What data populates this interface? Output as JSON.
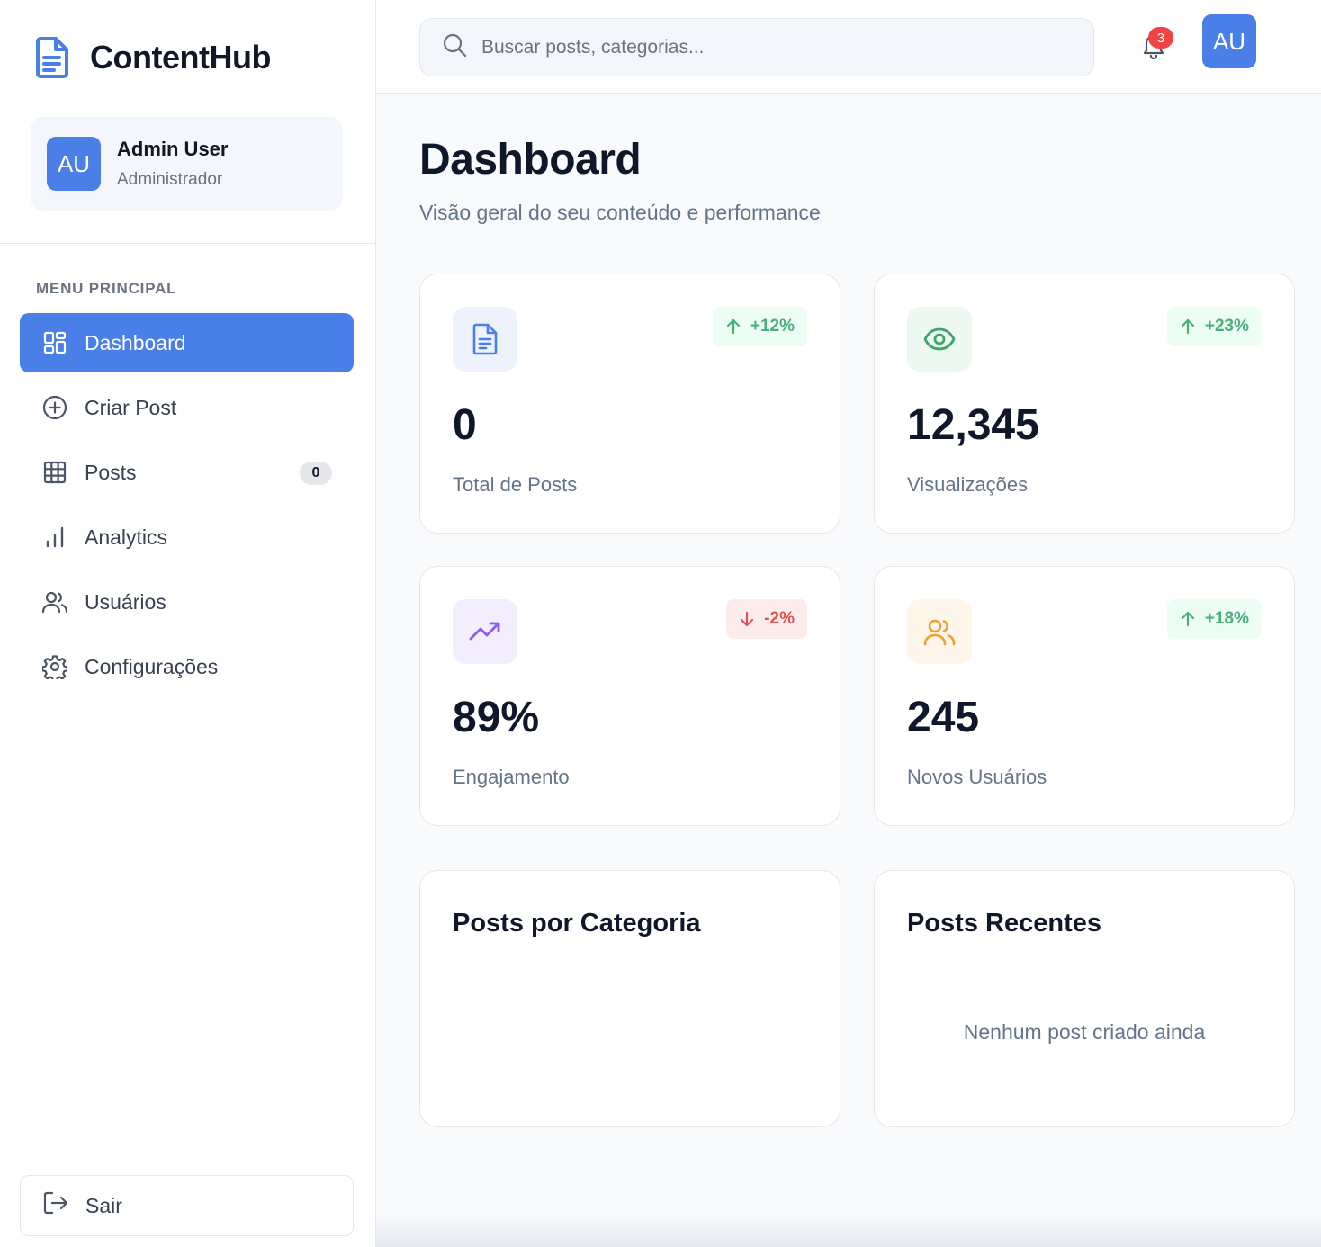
{
  "app": {
    "name": "ContentHub",
    "icon": "file-text-icon"
  },
  "user": {
    "initials": "AU",
    "name": "Admin User",
    "role": "Administrador"
  },
  "sidebar": {
    "menu_heading": "MENU PRINCIPAL",
    "items": [
      {
        "label": "Dashboard",
        "icon": "dashboard-grid-icon",
        "active": true
      },
      {
        "label": "Criar Post",
        "icon": "plus-circle-icon"
      },
      {
        "label": "Posts",
        "icon": "table-grid-icon",
        "badge": "0"
      },
      {
        "label": "Analytics",
        "icon": "bar-chart-icon"
      },
      {
        "label": "Usuários",
        "icon": "users-icon"
      },
      {
        "label": "Configurações",
        "icon": "gear-icon"
      }
    ],
    "logout_label": "Sair"
  },
  "topbar": {
    "search_placeholder": "Buscar posts, categorias...",
    "notification_count": "3",
    "avatar_initials": "AU"
  },
  "page": {
    "title": "Dashboard",
    "subtitle": "Visão geral do seu conteúdo e performance"
  },
  "stats": [
    {
      "value": "0",
      "label": "Total de Posts",
      "trend": "+12%",
      "direction": "up",
      "icon": "document-icon",
      "accent": "#4a7fe8",
      "icon_bg": "#eef2fd"
    },
    {
      "value": "12,345",
      "label": "Visualizações",
      "trend": "+23%",
      "direction": "up",
      "icon": "eye-icon",
      "accent": "#3fa46a",
      "icon_bg": "#edf8f1"
    },
    {
      "value": "89%",
      "label": "Engajamento",
      "trend": "-2%",
      "direction": "down",
      "icon": "trending-up-icon",
      "accent": "#8b5cf6",
      "icon_bg": "#f3eefd"
    },
    {
      "value": "245",
      "label": "Novos Usuários",
      "trend": "+18%",
      "direction": "up",
      "icon": "users-icon",
      "accent": "#f0a030",
      "icon_bg": "#fef6ea"
    }
  ],
  "panels": {
    "categories": {
      "title": "Posts por Categoria"
    },
    "recent": {
      "title": "Posts Recentes",
      "empty_text": "Nenhum post criado ainda"
    }
  },
  "colors": {
    "primary": "#4a7fe8",
    "positive": "#4caf7a",
    "negative": "#e05252",
    "notification": "#ef4444"
  }
}
